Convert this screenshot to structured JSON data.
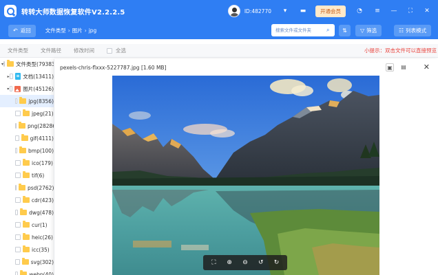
{
  "app": {
    "title": "转转大师数据恢复软件V2.2.2.5",
    "user_id": "ID:482770",
    "vip_label": "开通会员"
  },
  "toolbar": {
    "back_label": "返回",
    "breadcrumb": [
      "文件类型",
      "图片",
      "jpg"
    ],
    "search_placeholder": "搜索文件或文件夹",
    "filter_label": "筛选",
    "list_mode_label": "列表模式"
  },
  "columns": {
    "type": "文件类型",
    "path": "文件路径",
    "modified": "修改时间",
    "select_all": "全选"
  },
  "tip": "小提示：双击文件可以直接预览",
  "tree": [
    {
      "label": "文件类型(79383",
      "level": 0,
      "expanded": true,
      "icon": "folder"
    },
    {
      "label": "文档(13411)",
      "level": 1,
      "expanded": false,
      "icon": "doc"
    },
    {
      "label": "图片(45126)",
      "level": 1,
      "expanded": true,
      "icon": "image"
    },
    {
      "label": "jpg(8356)",
      "level": 2,
      "selected": true,
      "icon": "folder"
    },
    {
      "label": "jpeg(21)",
      "level": 2,
      "icon": "folder"
    },
    {
      "label": "png(28286",
      "level": 2,
      "icon": "folder"
    },
    {
      "label": "gif(4111)",
      "level": 2,
      "icon": "folder"
    },
    {
      "label": "bmp(100)",
      "level": 2,
      "icon": "folder"
    },
    {
      "label": "ico(179)",
      "level": 2,
      "icon": "folder"
    },
    {
      "label": "tif(6)",
      "level": 2,
      "icon": "folder"
    },
    {
      "label": "psd(2762)",
      "level": 2,
      "icon": "folder"
    },
    {
      "label": "cdr(423)",
      "level": 2,
      "icon": "folder"
    },
    {
      "label": "dwg(478)",
      "level": 2,
      "icon": "folder"
    },
    {
      "label": "cur(1)",
      "level": 2,
      "icon": "folder"
    },
    {
      "label": "heic(26)",
      "level": 2,
      "icon": "folder"
    },
    {
      "label": "icc(35)",
      "level": 2,
      "icon": "folder"
    },
    {
      "label": "svg(302)",
      "level": 2,
      "icon": "folder"
    },
    {
      "label": "webp(40)",
      "level": 2,
      "icon": "folder"
    }
  ],
  "preview": {
    "title": "pexels-chris-flxxx-5227787.jpg [1.60 MB]"
  },
  "colors": {
    "brand": "#2f7ef3",
    "tip": "#e8423b",
    "selected_row": "#e4efff"
  }
}
